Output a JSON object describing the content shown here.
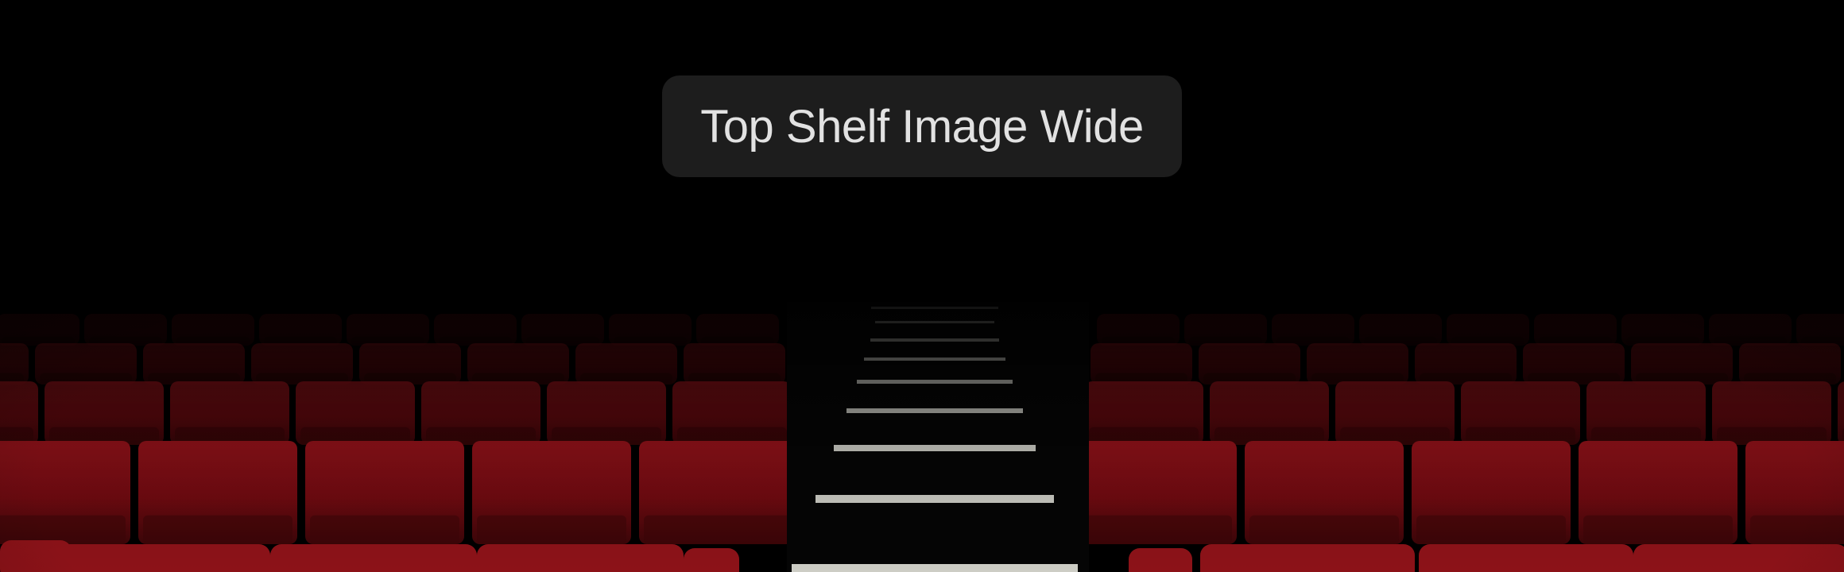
{
  "overlay": {
    "title": "Top Shelf Image Wide"
  },
  "scene": {
    "subject": "dark theater with red seats and lit aisle stairs",
    "colors": {
      "background": "#000000",
      "seat_red": "#7a0c12",
      "seat_red_dark": "#3a0507",
      "step_light": "#d8d8d0",
      "pill_background": "#1e1e1e",
      "title_text": "#e2e2e2"
    }
  }
}
